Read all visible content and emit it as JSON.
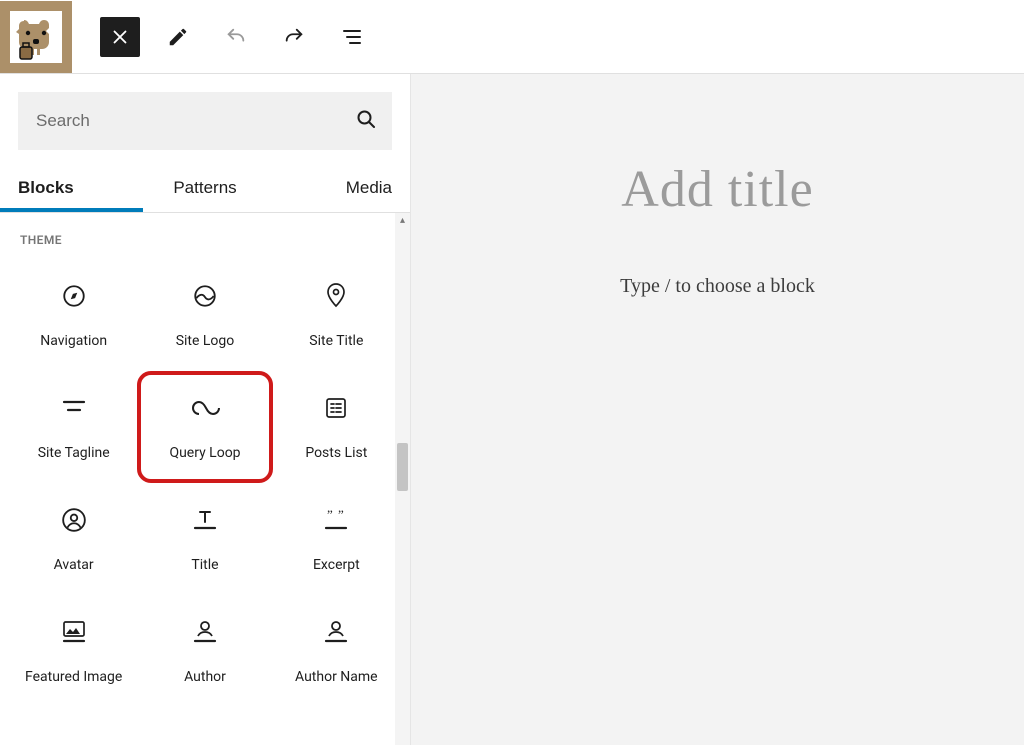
{
  "search": {
    "placeholder": "Search"
  },
  "tabs": [
    "Blocks",
    "Patterns",
    "Media"
  ],
  "activeTab": 0,
  "section_label": "THEME",
  "blocks": [
    {
      "name": "Navigation",
      "icon": "compass"
    },
    {
      "name": "Site Logo",
      "icon": "site-logo"
    },
    {
      "name": "Site Title",
      "icon": "map-pin"
    },
    {
      "name": "Site Tagline",
      "icon": "tagline"
    },
    {
      "name": "Query Loop",
      "icon": "loop",
      "highlight": true
    },
    {
      "name": "Posts List",
      "icon": "posts-list"
    },
    {
      "name": "Avatar",
      "icon": "avatar"
    },
    {
      "name": "Title",
      "icon": "title"
    },
    {
      "name": "Excerpt",
      "icon": "excerpt"
    },
    {
      "name": "Featured Image",
      "icon": "featured-image"
    },
    {
      "name": "Author",
      "icon": "author"
    },
    {
      "name": "Author Name",
      "icon": "author-name"
    }
  ],
  "canvas": {
    "title_placeholder": "Add title",
    "body_placeholder": "Type / to choose a block"
  },
  "colors": {
    "wp_blue": "#007cba",
    "highlight_red": "#cf1a1a"
  }
}
